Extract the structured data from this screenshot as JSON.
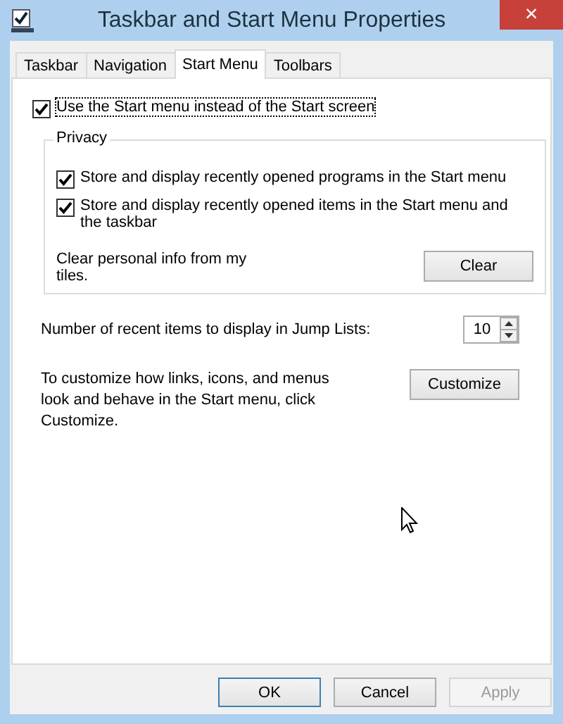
{
  "window": {
    "title": "Taskbar and Start Menu Properties",
    "close": "×"
  },
  "tabs": [
    {
      "label": "Taskbar",
      "selected": false
    },
    {
      "label": "Navigation",
      "selected": false
    },
    {
      "label": "Start Menu",
      "selected": true
    },
    {
      "label": "Toolbars",
      "selected": false
    }
  ],
  "start_menu_option": {
    "label": "Use the Start menu instead of the Start screen",
    "checked": true
  },
  "privacy": {
    "title": "Privacy",
    "options": [
      {
        "label": "Store and display recently opened programs in the Start menu",
        "checked": true
      },
      {
        "label": "Store and display recently opened items in the Start menu and the taskbar",
        "checked": true
      }
    ],
    "clear_text": "Clear personal info from my tiles.",
    "clear_button": "Clear"
  },
  "jump_lists": {
    "label": "Number of recent items to display in Jump Lists:",
    "value": "10"
  },
  "customize": {
    "text": "To customize how links, icons, and menus look and behave in the Start menu, click Customize.",
    "button": "Customize"
  },
  "buttons": [
    {
      "label": "OK",
      "default": true,
      "disabled": false
    },
    {
      "label": "Cancel",
      "default": false,
      "disabled": false
    },
    {
      "label": "Apply",
      "default": false,
      "disabled": true
    }
  ]
}
